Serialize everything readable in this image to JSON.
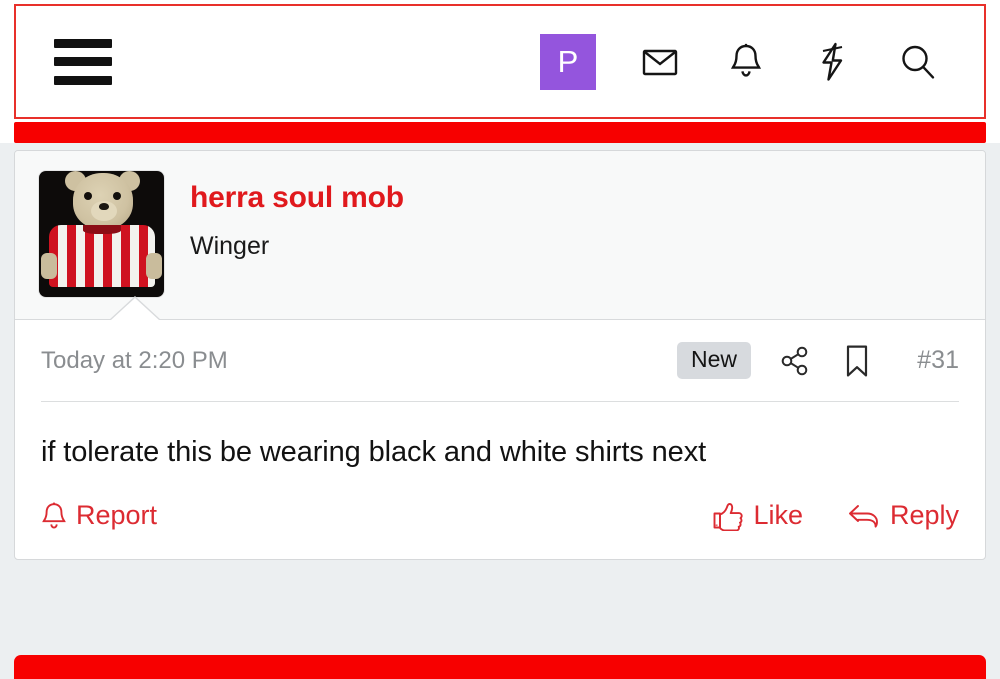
{
  "navbar": {
    "menu_icon": "hamburger-menu-icon",
    "avatar_initial": "P",
    "avatar_color": "#9455dd",
    "icons": [
      {
        "name": "mail-icon",
        "label": "Inbox"
      },
      {
        "name": "bell-icon",
        "label": "Alerts"
      },
      {
        "name": "bolt-icon",
        "label": "What's new"
      },
      {
        "name": "search-icon",
        "label": "Search"
      }
    ]
  },
  "post": {
    "user": {
      "username": "herra soul mob",
      "user_title": "Winger",
      "username_color": "#e0191d",
      "avatar_alt": "teddy-bear-in-red-and-white-striped-shirt"
    },
    "date": "Today at 2:20 PM",
    "badge": "New",
    "share_icon": "share-icon",
    "bookmark_icon": "bookmark-icon",
    "post_number": "#31",
    "message": "if tolerate this be wearing black and white shirts next",
    "actions": {
      "report": "Report",
      "like": "Like",
      "reply": "Reply",
      "action_color": "#dc2b32"
    }
  },
  "theme": {
    "accent_red": "#f70000",
    "page_background": "#eceff1",
    "card_background": "#ffffff",
    "user_band_background": "#f8f9f9",
    "badge_background": "#d7dade",
    "muted_text": "#8a8d90"
  }
}
